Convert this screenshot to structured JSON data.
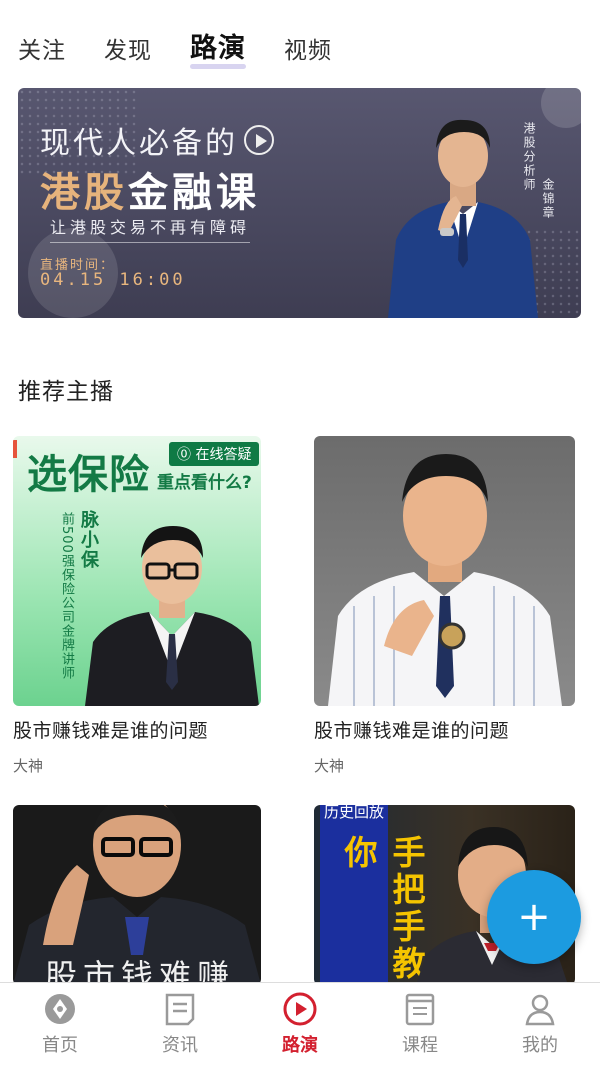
{
  "top_tabs": [
    {
      "label": "关注"
    },
    {
      "label": "发现"
    },
    {
      "label": "路演",
      "active": true
    },
    {
      "label": "视频"
    }
  ],
  "banner": {
    "line1": "现代人必备的",
    "title_gold": "港股",
    "title_white": "金融课",
    "tagline": "让港股交易不再有障碍",
    "time_label": "直播时间：",
    "time_value": "04.15 16:00",
    "presenter_role": "港股分析师",
    "presenter_name": "金锦章"
  },
  "section": {
    "title": "推荐主播"
  },
  "cards": [
    {
      "title": "股市赚钱难是谁的问题",
      "subtitle": "大神",
      "thumb": {
        "headline": "选保险",
        "badge": "⓪ 在线答疑",
        "sub": "重点看什么?",
        "name": "脉小保",
        "desc": "前500强保险公司金牌讲师"
      }
    },
    {
      "title": "股市赚钱难是谁的问题",
      "subtitle": "大神"
    },
    {
      "thumb_text": "股市钱难赚"
    },
    {
      "thumb_head": "历史回放",
      "thumb_vtext": "手把手教你"
    }
  ],
  "fab": {
    "label": "+",
    "color": "#1c9be0"
  },
  "bottom_nav": [
    {
      "label": "首页",
      "icon": "home-compass-icon"
    },
    {
      "label": "资讯",
      "icon": "news-icon"
    },
    {
      "label": "路演",
      "icon": "play-circle-icon",
      "active": true
    },
    {
      "label": "课程",
      "icon": "course-book-icon"
    },
    {
      "label": "我的",
      "icon": "user-icon"
    }
  ],
  "colors": {
    "accent_red": "#d3202f",
    "fab_blue": "#1c9be0",
    "banner_gold": "#e6b37c"
  }
}
